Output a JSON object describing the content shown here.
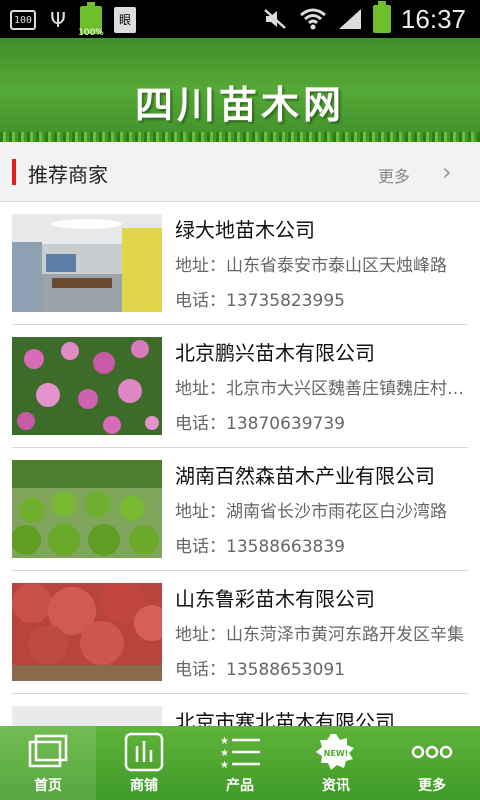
{
  "status_bar": {
    "left_box_text": "100",
    "battery_percent_text": "100%",
    "doc_icon_text": "眼",
    "time": "16:37"
  },
  "header": {
    "logo_text": "四川苗木网"
  },
  "section": {
    "title": "推荐商家",
    "more_label": "更多"
  },
  "merchants": [
    {
      "name": "绿大地苗木公司",
      "address": "地址：山东省泰安市泰山区天烛峰路",
      "phone": "电话：13735823995",
      "image": "office-room"
    },
    {
      "name": "北京鹏兴苗木有限公司",
      "address": "地址：北京市大兴区魏善庄镇魏庄村…",
      "phone": "电话：13870639739",
      "image": "pink-flowers"
    },
    {
      "name": "湖南百然森苗木产业有限公司",
      "address": "地址：湖南省长沙市雨花区白沙湾路",
      "phone": "电话：13588663839",
      "image": "round-shrubs"
    },
    {
      "name": "山东鲁彩苗木有限公司",
      "address": "地址：山东菏泽市黄河东路开发区辛集",
      "phone": "电话：13588653091",
      "image": "red-maples"
    },
    {
      "name": "北京市塞北苗木有限公司",
      "address": "",
      "phone": "",
      "image": "gray-building"
    }
  ],
  "bottom_nav": [
    {
      "label": "首页",
      "icon": "home-icon",
      "active": true
    },
    {
      "label": "商铺",
      "icon": "shop-icon",
      "active": false
    },
    {
      "label": "产品",
      "icon": "products-icon",
      "active": false
    },
    {
      "label": "资讯",
      "icon": "news-icon",
      "active": false
    },
    {
      "label": "更多",
      "icon": "more-icon",
      "active": false
    }
  ],
  "colors": {
    "header_green": "#55a936",
    "section_accent": "#e01e1e",
    "nav_green": "#4fa830"
  }
}
